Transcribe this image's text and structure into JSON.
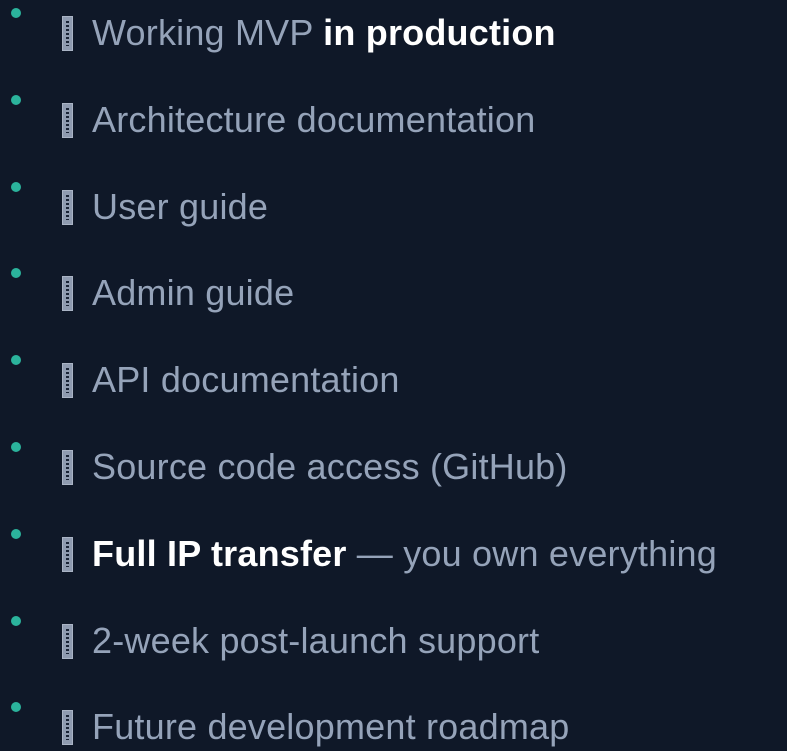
{
  "deliverables": {
    "items": [
      {
        "pre": "",
        "normal": "Working MVP ",
        "strong": "in production",
        "post": ""
      },
      {
        "pre": "",
        "normal": "Architecture documentation",
        "strong": "",
        "post": ""
      },
      {
        "pre": "",
        "normal": "User guide",
        "strong": "",
        "post": ""
      },
      {
        "pre": "",
        "normal": "Admin guide",
        "strong": "",
        "post": ""
      },
      {
        "pre": "",
        "normal": "API documentation",
        "strong": "",
        "post": ""
      },
      {
        "pre": "",
        "normal": "Source code access (GitHub)",
        "strong": "",
        "post": ""
      },
      {
        "pre": "Full IP transfer",
        "normal": "",
        "strong": "",
        "post": " — you own everything"
      },
      {
        "pre": "",
        "normal": "2-week post-launch support",
        "strong": "",
        "post": ""
      },
      {
        "pre": "",
        "normal": "Future development roadmap",
        "strong": "",
        "post": ""
      }
    ],
    "glyph_placeholder": "NO GLYPH",
    "colors": {
      "background": "#0f1828",
      "bullet": "#2bb39c",
      "text": "#95a3b9",
      "strong": "#ffffff"
    }
  }
}
